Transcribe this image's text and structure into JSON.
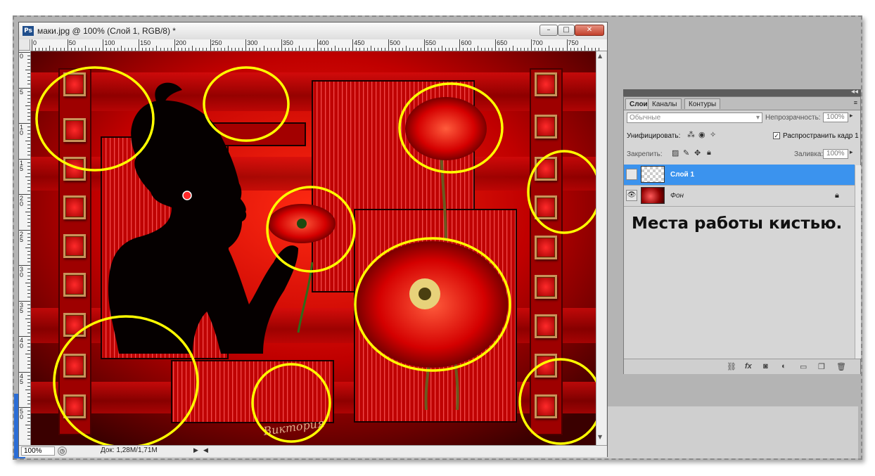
{
  "document": {
    "title": "маки.jpg @ 100% (Слой 1, RGB/8) *",
    "app_icon": "Ps",
    "buttons": {
      "minimize": "–",
      "maximize": "□",
      "close": "✕"
    },
    "ruler_top_labels": [
      "0",
      "50",
      "100",
      "150",
      "200",
      "250",
      "300",
      "350",
      "400",
      "450",
      "500",
      "550",
      "600",
      "650",
      "700",
      "750"
    ],
    "ruler_left_labels": [
      "0",
      "5",
      "10",
      "15",
      "20",
      "25",
      "30",
      "35",
      "40",
      "45",
      "50"
    ],
    "signature": "Виктория",
    "status": {
      "zoom": "100%",
      "doc_info": "Док: 1,28M/1,71M",
      "arrow_right": "▶",
      "arrow_left": "◀"
    },
    "scroll": {
      "up": "▲",
      "down": "▼"
    }
  },
  "layers_panel": {
    "collapse": "◂◂",
    "tabs": [
      "Слои",
      "Каналы",
      "Контуры"
    ],
    "menu_icon": "≡",
    "blend_mode": "Обычные",
    "opacity_label": "Непрозрачность:",
    "opacity_value": "100%",
    "unify_label": "Унифицировать:",
    "propagate_label": "Распространить кадр 1",
    "lock_label": "Закрепить:",
    "fill_label": "Заливка:",
    "fill_value": "100%",
    "layers": [
      {
        "name": "Слой 1",
        "selected": true,
        "visible": false
      },
      {
        "name": "Фон",
        "selected": false,
        "visible": true
      }
    ],
    "bottom_icons": [
      "link-icon",
      "fx-icon",
      "mask-icon",
      "adjustment-icon",
      "group-icon",
      "new-layer-icon",
      "trash-icon"
    ]
  },
  "annotation": "Места работы кистью.",
  "colors": {
    "highlight": "#ffff00",
    "selection": "#3b93ee",
    "canvas_red": "#c40000"
  }
}
